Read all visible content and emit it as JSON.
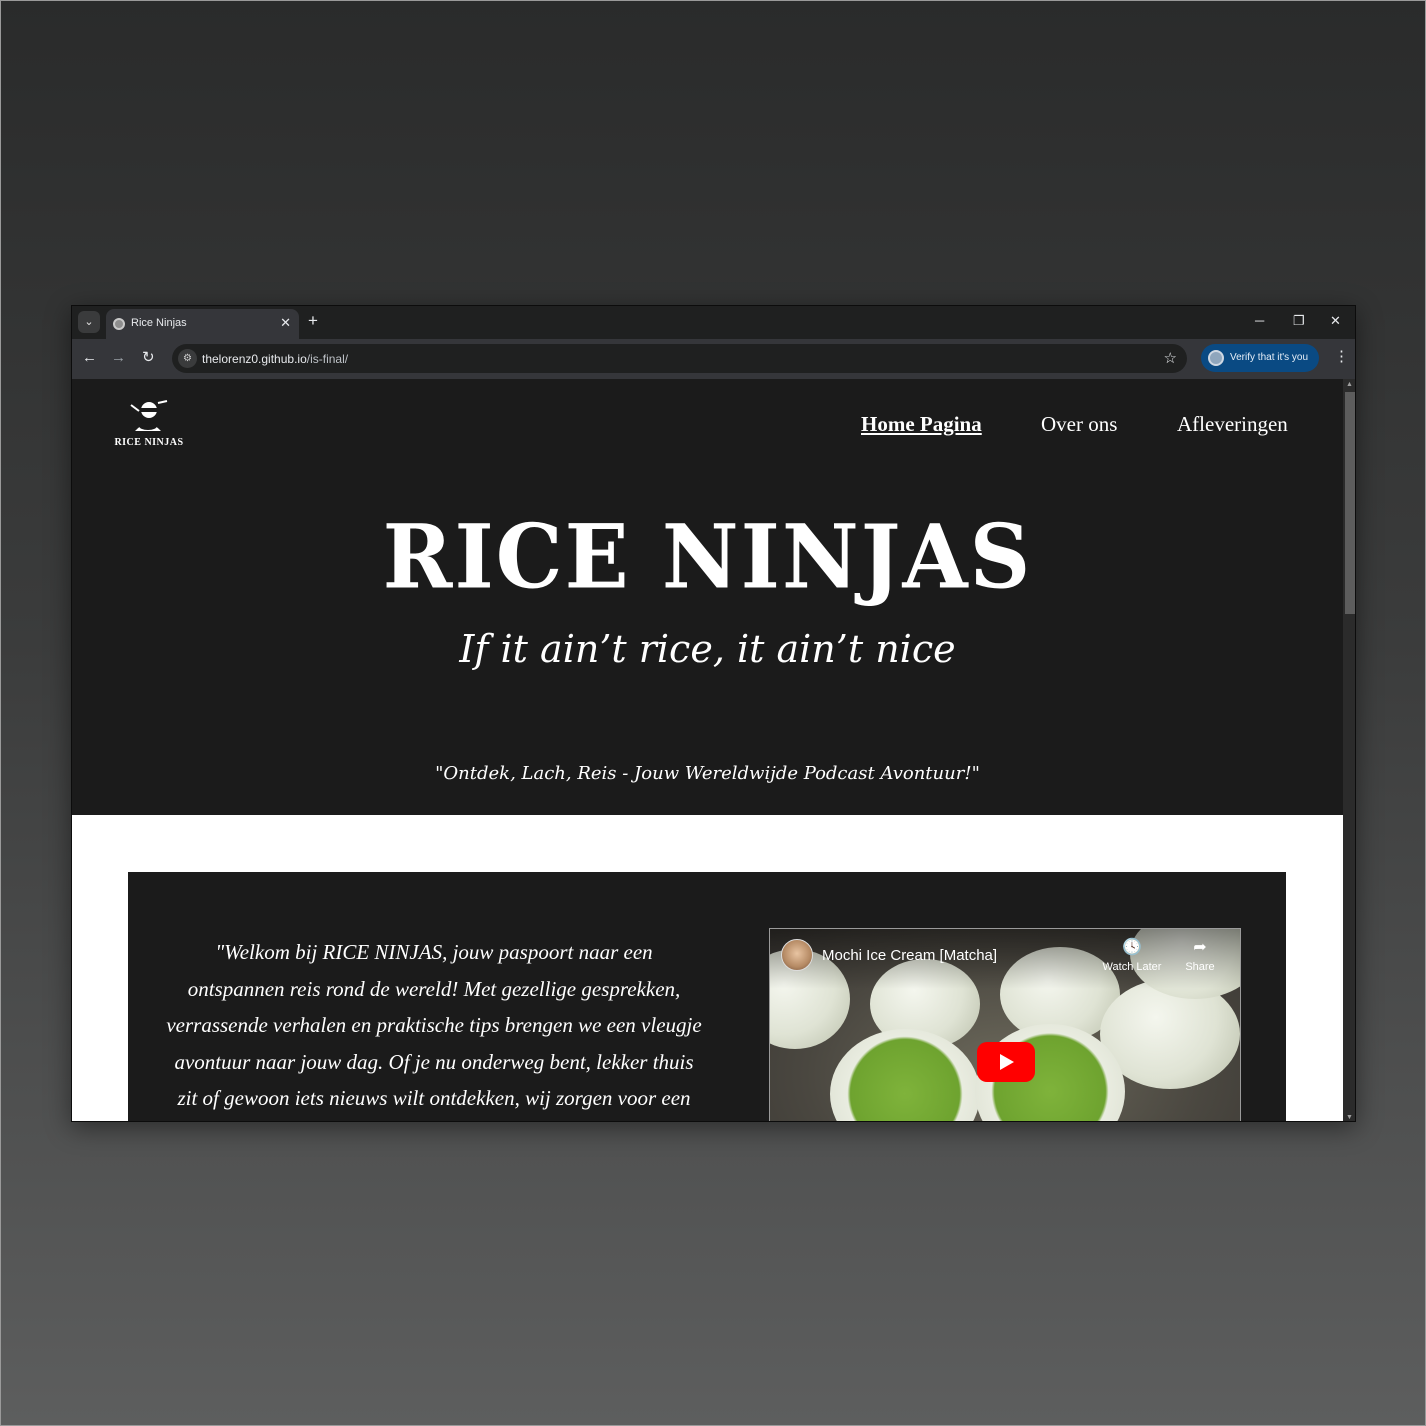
{
  "browser": {
    "tab_title": "Rice Ninjas",
    "new_tab_icon": "+",
    "url_host": "thelorenz0.github.io",
    "url_path": "/is-final/",
    "verify_label": "Verify that it's you"
  },
  "site": {
    "logo_text": "RICE NINJAS",
    "nav": [
      {
        "label": "Home Pagina",
        "active": true
      },
      {
        "label": "Over ons",
        "active": false
      },
      {
        "label": "Afleveringen",
        "active": false
      }
    ],
    "hero_title": "RICE NINJAS",
    "hero_tagline": "If it ain’t rice, it ain’t nice",
    "hero_quote": "\"Ontdek, Lach, Reis - Jouw Wereldwijde Podcast Avontuur!\"",
    "intro_text": "\"Welkom bij RICE NINJAS, jouw paspoort naar een ontspannen reis rond de wereld! Met gezellige gesprekken, verrassende verhalen en praktische tips brengen we een vleugje avontuur naar jouw dag. Of je nu onderweg bent, lekker thuis zit of gewoon iets nieuws wilt ontdekken, wij zorgen voor een mix van",
    "video": {
      "title": "Mochi Ice Cream [Matcha]",
      "watch_later": "Watch Later",
      "share": "Share"
    }
  },
  "colors": {
    "hero_bg": "#1b1b1b",
    "page_bg": "#ffffff",
    "yt_red": "#ff0000",
    "verify_chip": "#0a4a83"
  }
}
